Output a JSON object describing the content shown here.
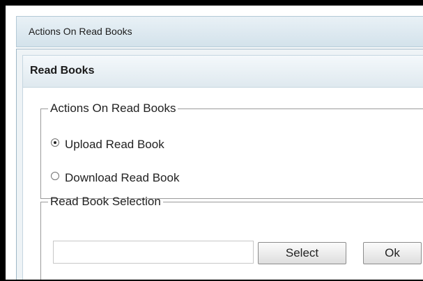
{
  "window": {
    "title": "Actions On Read Books"
  },
  "dialog": {
    "title": "Read Books",
    "actions_group": {
      "legend": "Actions On Read Books",
      "options": [
        {
          "label": "Upload Read Book",
          "checked": true
        },
        {
          "label": "Download Read Book",
          "checked": false
        }
      ]
    },
    "selection_group": {
      "legend": "Read Book Selection",
      "file_input": {
        "value": "",
        "placeholder": ""
      },
      "select_label": "Select",
      "ok_label": "Ok"
    }
  }
}
